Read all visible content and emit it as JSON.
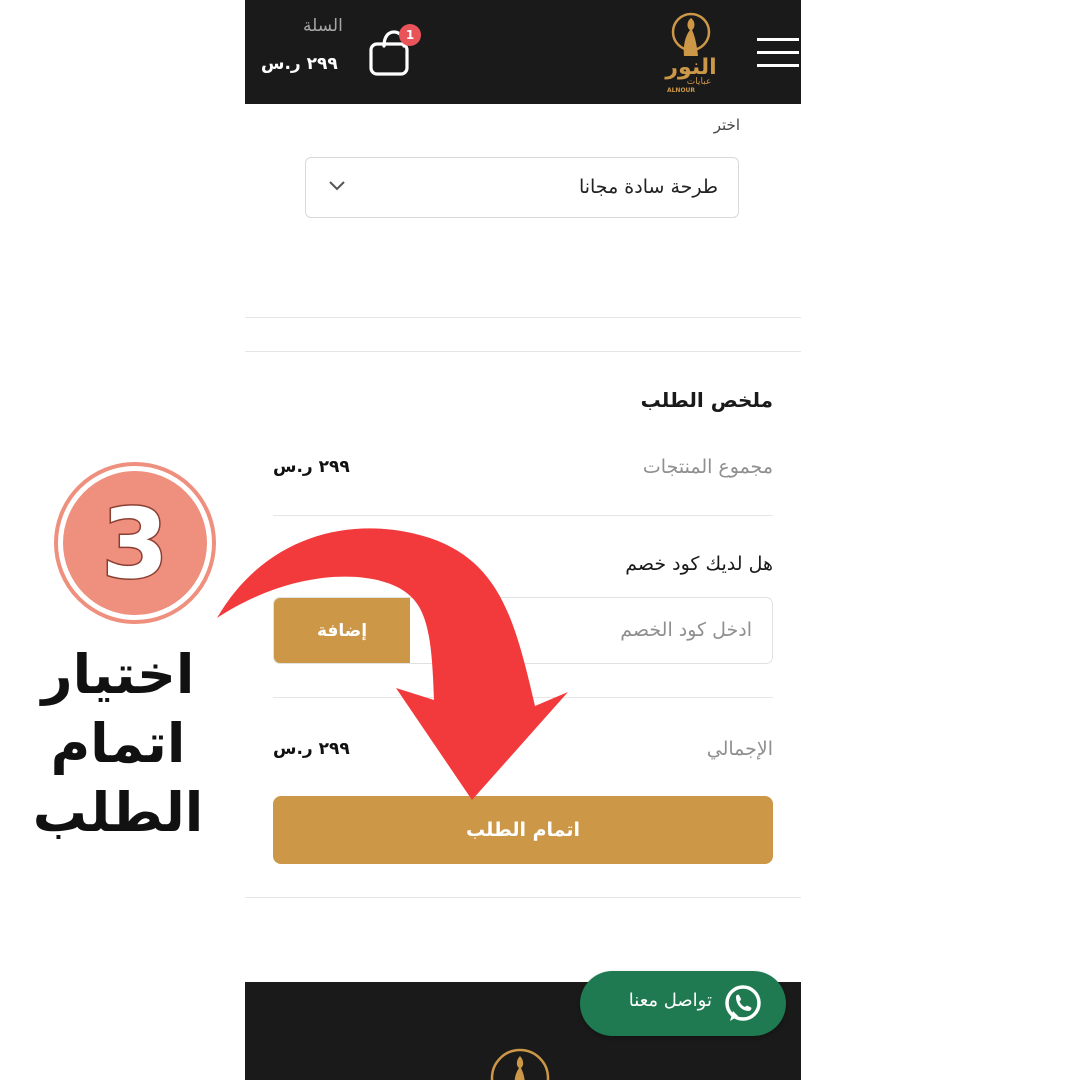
{
  "header": {
    "cart_title": "السلة",
    "cart_total": "٢٩٩ ر.س",
    "cart_count": "1",
    "brand_name": "النور",
    "brand_sub": "عبايات",
    "brand_latin": "ALNOUR"
  },
  "select": {
    "label": "اختر",
    "value": "طرحة سادة مجانا"
  },
  "summary": {
    "title": "ملخص الطلب",
    "subtotal_label": "مجموع المنتجات",
    "subtotal_value": "٢٩٩ ر.س",
    "coupon_question": "هل لديك كود خصم",
    "coupon_placeholder": "ادخل كود الخصم",
    "coupon_button": "إضافة",
    "total_label": "الإجمالي",
    "total_value": "٢٩٩ ر.س",
    "checkout_button": "اتمام الطلب"
  },
  "whatsapp": {
    "label": "تواصل معنا"
  },
  "annotation": {
    "step_number": "3",
    "caption_lines": [
      "اختيار",
      "اتمام",
      "الطلب"
    ]
  },
  "colors": {
    "accent_gold": "#cc9747",
    "header_dark": "#1a1a1a",
    "whatsapp_green": "#1f7a52",
    "arrow_red": "#f23a3c",
    "step_circle": "#ef8f7d"
  }
}
